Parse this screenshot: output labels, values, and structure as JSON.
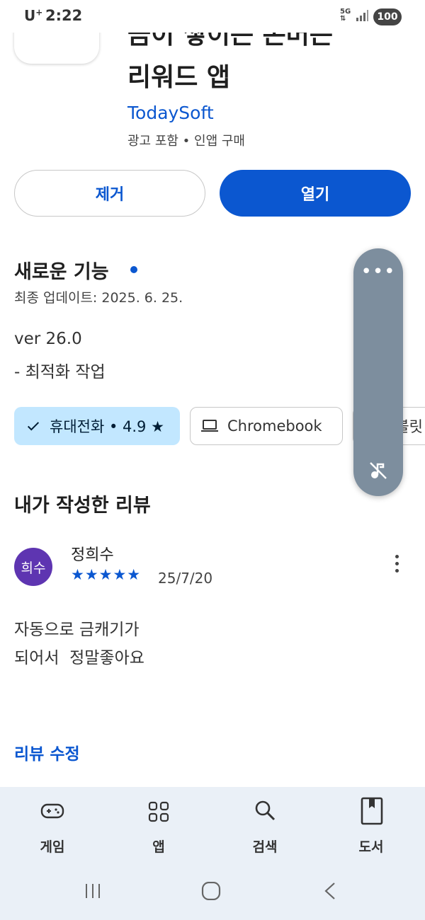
{
  "status_bar": {
    "carrier": "U",
    "carrier_sup": "+",
    "time": "2:22",
    "network": "5G",
    "battery": "100"
  },
  "app": {
    "title_line1": "금이 쌓이는 돈버는",
    "title_line2": "리워드 앱",
    "developer": "TodaySoft",
    "meta": "광고 포함 • 인앱 구매"
  },
  "actions": {
    "remove_label": "제거",
    "open_label": "열기"
  },
  "whats_new": {
    "title": "새로운 기능",
    "updated": "최종 업데이트: 2025. 6. 25.",
    "notes_line1": "ver 26.0",
    "notes_line2": "- 최적화 작업"
  },
  "device_chips": {
    "phone_label": "휴대전화 • 4.9 ★",
    "chromebook_label": "Chromebook",
    "tablet_label": "태블릿"
  },
  "floating_panel": {
    "more_label": "•••"
  },
  "my_review": {
    "heading": "내가 작성한 리뷰",
    "avatar_text": "희수",
    "reviewer": "정희수",
    "stars_display": "★★★★★",
    "rating": 5,
    "date": "25/7/20",
    "text_line1": "자동으로 금캐기가",
    "text_line2": "되어서  정말좋아요",
    "edit_label": "리뷰 수정"
  },
  "bottom_nav": {
    "items": [
      {
        "label": "게임",
        "icon": "gamepad-icon"
      },
      {
        "label": "앱",
        "icon": "apps-grid-icon"
      },
      {
        "label": "검색",
        "icon": "search-icon"
      },
      {
        "label": "도서",
        "icon": "book-icon"
      }
    ]
  },
  "colors": {
    "accent": "#0b57d0",
    "chip_selected": "#c2e7ff",
    "avatar": "#5e35b1",
    "float_panel": "#7d8e9e",
    "nav_bg": "#eaf0f7"
  }
}
